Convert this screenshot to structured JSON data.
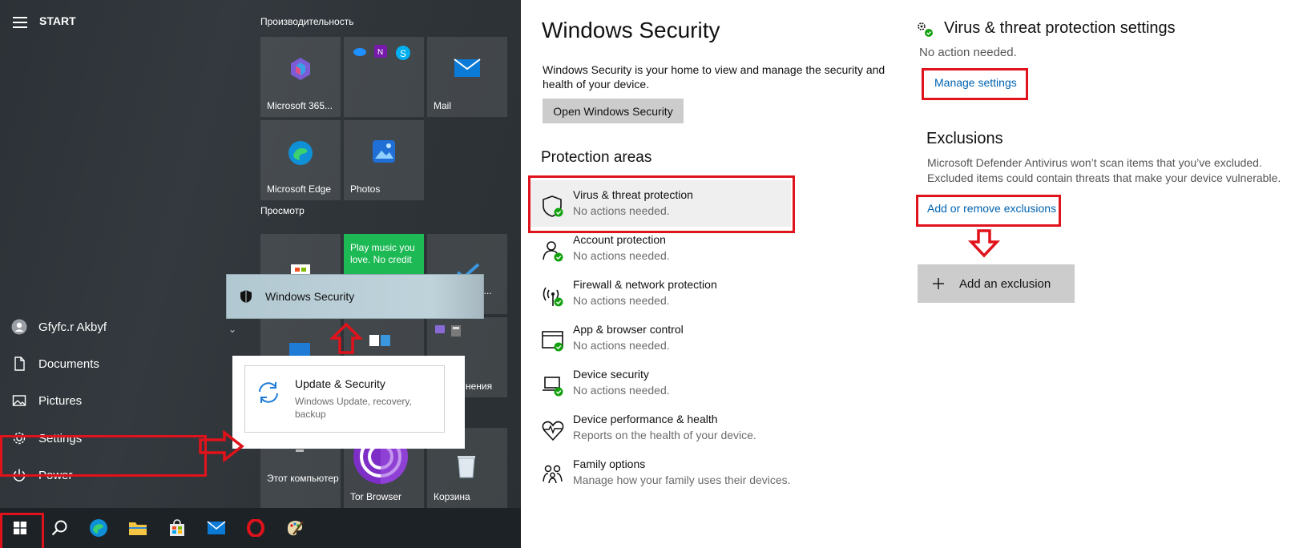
{
  "start_menu": {
    "title": "START",
    "rail": {
      "user": "Gfyfc.r Akbyf",
      "documents": "Documents",
      "pictures": "Pictures",
      "settings": "Settings",
      "power": "Power"
    },
    "groups": {
      "productivity": "Производительность",
      "explore": "Просмотр"
    },
    "tiles": {
      "m365": "Microsoft 365...",
      "mail": "Mail",
      "edge": "Microsoft Edge",
      "photos": "Photos",
      "spotify_promo": "Play music you love. No credit",
      "this_pc": "Этот компьютер",
      "tor": "Tor Browser",
      "recycle": "Корзина",
      "partial_label_a": "нения",
      "partial_label_b": "о..."
    },
    "flyouts": {
      "windows_security": "Windows Security",
      "update_security_title": "Update & Security",
      "update_security_sub": "Windows Update, recovery, backup"
    }
  },
  "windows_security": {
    "title": "Windows Security",
    "description": "Windows Security is your home to view and manage the security and health of your device.",
    "open_button": "Open Windows Security",
    "protection_areas_heading": "Protection areas",
    "areas": [
      {
        "title": "Virus & threat protection",
        "sub": "No actions needed.",
        "icon": "shield-icon"
      },
      {
        "title": "Account protection",
        "sub": "No actions needed.",
        "icon": "person-icon"
      },
      {
        "title": "Firewall & network protection",
        "sub": "No actions needed.",
        "icon": "wifi-antenna-icon"
      },
      {
        "title": "App & browser control",
        "sub": "No actions needed.",
        "icon": "browser-window-icon"
      },
      {
        "title": "Device security",
        "sub": "No actions needed.",
        "icon": "laptop-icon"
      },
      {
        "title": "Device performance & health",
        "sub": "Reports on the health of your device.",
        "icon": "heart-pulse-icon"
      },
      {
        "title": "Family options",
        "sub": "Manage how your family uses their devices.",
        "icon": "family-icon"
      }
    ]
  },
  "virus_settings": {
    "title": "Virus & threat protection settings",
    "status": "No action needed.",
    "manage_link": "Manage settings",
    "exclusions_heading": "Exclusions",
    "exclusions_desc_1": "Microsoft Defender Antivirus won’t scan items that you’ve excluded.",
    "exclusions_desc_2": "Excluded items could contain threats that make your device vulnerable.",
    "exclusions_link": "Add or remove exclusions",
    "add_exclusion_button": "Add an exclusion"
  },
  "colors": {
    "annotation_red": "#e0121b",
    "link_blue": "#0063b1",
    "status_green": "#13a10e",
    "spotify_green": "#1db954"
  }
}
